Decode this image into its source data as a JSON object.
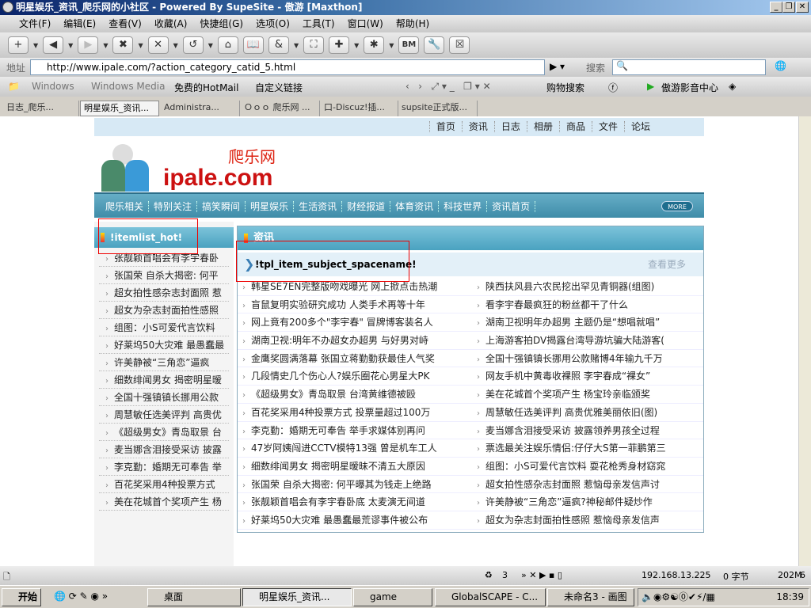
{
  "window": {
    "title": "明星娱乐_资讯_爬乐网的小社区 - Powered By SupeSite - 傲游 [Maxthon]"
  },
  "menu": [
    "文件(F)",
    "编辑(E)",
    "查看(V)",
    "收藏(A)",
    "快捷组(G)",
    "选项(O)",
    "工具(T)",
    "窗口(W)",
    "帮助(H)"
  ],
  "toolbar": {
    "bm_label": "BM"
  },
  "address": {
    "label": "地址",
    "url": "http://www.ipale.com/?action_category_catid_5.html",
    "search_label": "搜索"
  },
  "links": {
    "items": [
      "Windows",
      "Windows Media",
      "免费的HotMail",
      "自定义链接"
    ],
    "right": [
      "购物搜索",
      "傲游影音中心"
    ]
  },
  "tabs": [
    "日志_爬乐...",
    "明星娱乐_资讯...",
    "Administra...",
    "Ｏｏｏ 爬乐网 ...",
    "口-Discuz!插...",
    "supsite正式版..."
  ],
  "site": {
    "topnav": [
      "首页",
      "资讯",
      "日志",
      "相册",
      "商品",
      "文件",
      "论坛"
    ],
    "logo_cn": "爬乐网",
    "logo_en": "ipale.com",
    "mainnav": [
      "爬乐相关",
      "特别关注",
      "搞笑瞬间",
      "明星娱乐",
      "生活资讯",
      "财经报道",
      "体育资讯",
      "科技世界",
      "资讯首页"
    ],
    "more": "MORE",
    "left_title": "!itemlist_hot!",
    "left_items": [
      "张靓颖首唱会有李宇春卧",
      "张国荣 自杀大揭密: 何平",
      "超女拍性感杂志封面照 惹",
      "超女为杂志封面拍性感照",
      "组图：小S可爱代言饮料",
      "好莱坞50大灾难 最愚蠢最",
      "许美静被“三角恋”逼疯",
      "细数绯闻男女 揭密明星暧",
      "全国十强镇镇长挪用公款",
      "周慧敏任选美评判 高贵优",
      "《超级男女》青岛取景 台",
      "麦当娜含泪接受采访 披露",
      "李克勤：婚期无可奉告 举",
      "百花奖采用4种投票方式",
      "美在花城首个奖项产生 杨"
    ],
    "main_title": "资讯",
    "sub_title": "!tpl_item_subject_spacename!",
    "view_more": "查看更多",
    "col1": [
      "韩星SE7EN完整版吻戏曝光 网上掀点击热潮",
      "盲鼠复明实验研究成功 人类手术再等十年",
      "网上竟有200多个\"李宇春\" 冒牌博客装名人",
      "湖南卫视:明年不办超女办超男 与好男对峙",
      "金鹰奖圆满落幕 张国立蒋勤勤获最佳人气奖",
      "几段情史几个伤心人?娱乐圈花心男星大PK",
      "《超级男女》青岛取景 台湾黄维德被殴",
      "百花奖采用4种投票方式 投票量超过100万",
      "李克勤：婚期无可奉告 举手求媒体别再问",
      "47岁阿姨闯进CCTV模特13强 曾是机车工人",
      "细数绯闻男女 揭密明星暧昧不清五大原因",
      "张国荣 自杀大揭密: 何平曝其为钱走上绝路",
      "张靓颖首唱会有李宇春卧底 太麦演无间道",
      "好莱坞50大灾难 最愚蠢最荒谬事件被公布"
    ],
    "col2": [
      "陕西扶风县六农民挖出罕见青铜器(组图)",
      "看李宇春最疯狂的粉丝都干了什么",
      "湖南卫视明年办超男 主题仍是“想唱就唱”",
      "上海游客拍DV揭露台湾导游坑骗大陆游客(",
      "全国十强镇镇长挪用公款赌博4年输九千万",
      "网友手机中黄毒收裸照 李宇春成“裸女”",
      "美在花城首个奖项产生 杨宝玲亲临颁奖",
      "周慧敏任选美评判 高贵优雅美丽依旧(图)",
      "麦当娜含泪接受采访 披露领养男孩全过程",
      "票选最关注娱乐情侣:仔仔大S第一菲鹏第三",
      "组图：小S可爱代言饮料 耍花枪秀身材窈窕",
      "超女拍性感杂志封面照 惹恼母亲发信声讨",
      "许美静被“三角恋”逼疯?神秘邮件疑炒作",
      "超女为杂志封面拍性感照 惹恼母亲发信声"
    ]
  },
  "status": {
    "count": "3",
    "ip": "192.168.13.225",
    "bytes": "0 字节",
    "mem": "202M",
    "num": "6"
  },
  "taskbar": {
    "start": "开始",
    "tasks": [
      "桌面",
      "明星娱乐_资讯...",
      "game",
      "GlobalSCAPE - C...",
      "未命名3 - 画图"
    ],
    "clock": "18:39"
  },
  "colors": {
    "nav": "#4a9bb8",
    "topnav": "#d7e9f5",
    "highlight_box": "#ee0000"
  }
}
